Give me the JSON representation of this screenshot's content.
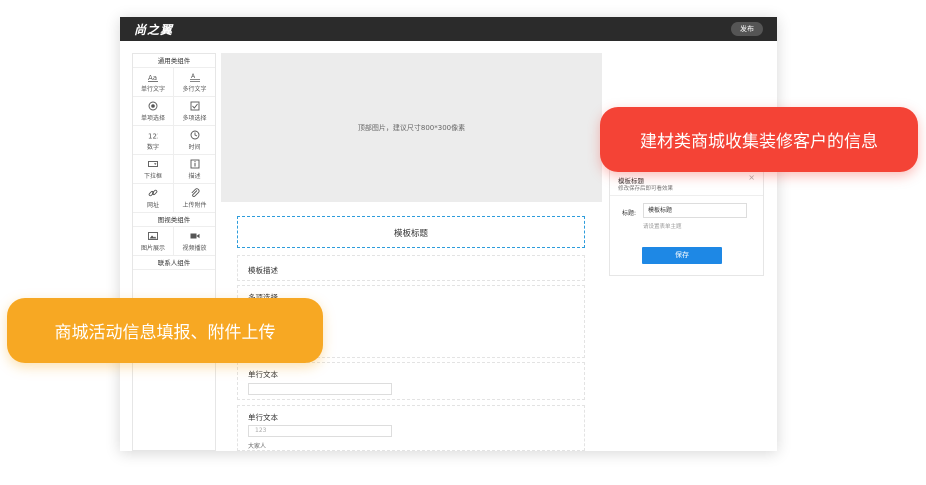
{
  "topbar": {
    "logo": "尚之翼",
    "publish_label": "发布"
  },
  "palette": {
    "groups": [
      {
        "title": "通用类组件",
        "items": [
          {
            "label": "单行文字",
            "icon": "single-line-text-icon"
          },
          {
            "label": "多行文字",
            "icon": "multi-line-text-icon"
          },
          {
            "label": "单项选择",
            "icon": "radio-icon"
          },
          {
            "label": "多项选择",
            "icon": "checkbox-icon"
          },
          {
            "label": "数字",
            "icon": "number-icon"
          },
          {
            "label": "时间",
            "icon": "clock-icon"
          },
          {
            "label": "下拉框",
            "icon": "dropdown-icon"
          },
          {
            "label": "描述",
            "icon": "description-icon"
          },
          {
            "label": "网址",
            "icon": "link-icon"
          },
          {
            "label": "上传附件",
            "icon": "attachment-icon"
          }
        ]
      },
      {
        "title": "图视类组件",
        "items": [
          {
            "label": "图片展示",
            "icon": "image-icon"
          },
          {
            "label": "视频播放",
            "icon": "video-icon"
          }
        ]
      },
      {
        "title": "联系人组件",
        "items": []
      }
    ]
  },
  "canvas": {
    "banner_hint": "顶部图片，建议尺寸800*300像素",
    "form_title": "模板标题",
    "form_description": "模板描述",
    "fields": [
      {
        "label": "多项选择"
      },
      {
        "label": "单行文本"
      },
      {
        "label": "单行文本",
        "value": "123",
        "sub": "大家人"
      }
    ]
  },
  "properties": {
    "title": "模板标题",
    "subtitle": "修改保存后即可看效果",
    "field_label": "标题:",
    "field_value": "模板标题",
    "hint": "请设置表单主题",
    "save_label": "保存"
  },
  "callouts": {
    "red": "建材类商城收集装修客户的信息",
    "yellow": "商城活动信息填报、附件上传"
  },
  "colors": {
    "topbar": "#2b2b2b",
    "accent": "#1e88e5",
    "red": "#f44336",
    "yellow": "#f7a823"
  }
}
